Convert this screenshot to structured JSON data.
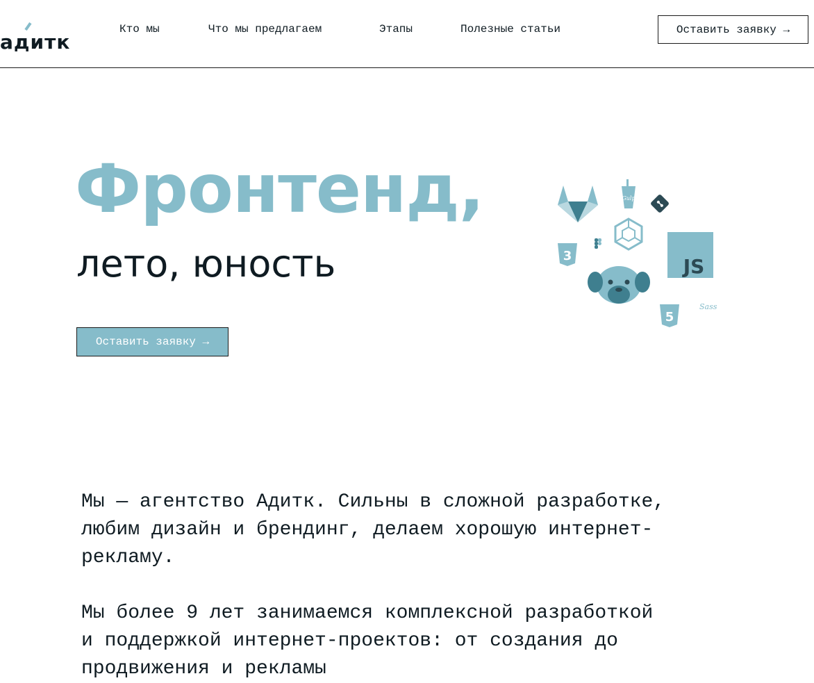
{
  "header": {
    "logo_text": "адитк",
    "nav": [
      {
        "label": "Кто мы"
      },
      {
        "label": "Что мы предлагаем"
      },
      {
        "label": "Этапы"
      },
      {
        "label": "Полезные статьи"
      }
    ],
    "cta_label": "Оставить заявку →"
  },
  "hero": {
    "title": "Фронтенд,",
    "subtitle": "лето, юность",
    "cta_label": "Оставить заявку →",
    "tech_icons": [
      "gitlab-icon",
      "gulp-icon",
      "git-icon",
      "webpack-icon",
      "figma-icon",
      "css3-icon",
      "javascript-icon",
      "pug-icon",
      "html5-icon",
      "sass-icon"
    ],
    "tech_labels": {
      "gulp": "Gulp",
      "css": "3",
      "js": "JS",
      "html": "5",
      "sass": "Sass"
    }
  },
  "about": {
    "paragraph1": "Мы — агентство Адитк. Сильны в сложной разработке, любим дизайн и брендинг, делаем хорошую интернет-рекламу.",
    "paragraph2": "Мы более 9 лет занимаемся комплексной разработкой и поддержкой интернет-проектов: от создания до продвижения и рекламы"
  },
  "colors": {
    "accent": "#86bcca",
    "accent_dark": "#3f7f8f",
    "text": "#0f1b22",
    "background": "#ffffff"
  }
}
